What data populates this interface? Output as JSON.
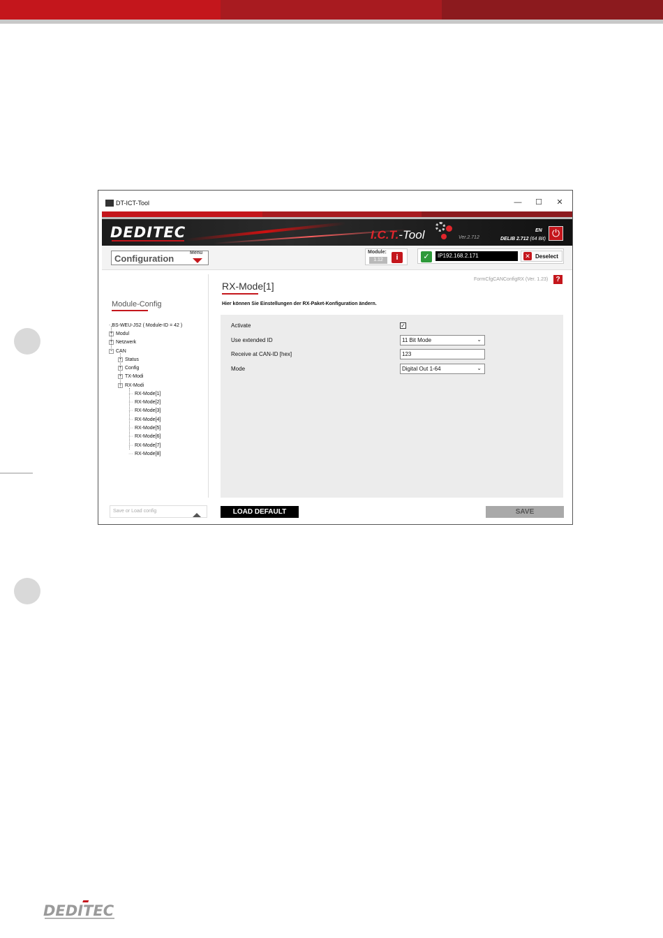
{
  "brand": {
    "red": "#c4161c",
    "dark_red": "#8c1a1e",
    "logo_text": "DEDITEC"
  },
  "window": {
    "title": "DT-ICT-Tool",
    "minimize_icon": "minimize-icon",
    "maximize_icon": "maximize-icon",
    "close_icon": "close-icon"
  },
  "header": {
    "logo": "DEDITEC",
    "product_red": "I.C.T.",
    "product_white": "-Tool",
    "version": "Ver.2.712",
    "language": "EN",
    "delib": "DELIB 2.712",
    "delib_arch": "(64 Bit)"
  },
  "toolbar": {
    "config_label": "Configuration",
    "menu_label": "Menu",
    "module_label": "Module:",
    "module_value": "1.12",
    "ip_address": "IP192.168.2.171",
    "deselect_label": "Deselect"
  },
  "sidebar": {
    "title": "Module-Config",
    "tree": {
      "root": "BS-WEU-JS2 ( Module-ID = 42 )",
      "modul": "Modul",
      "netzwerk": "Netzwerk",
      "can": "CAN",
      "status": "Status",
      "config": "Config",
      "tx_modi": "TX-Modi",
      "rx_modi": "RX-Modi",
      "rx_items": [
        "RX-Mode[1]",
        "RX-Mode[2]",
        "RX-Mode[3]",
        "RX-Mode[4]",
        "RX-Mode[5]",
        "RX-Mode[6]",
        "RX-Mode[7]",
        "RX-Mode[8]"
      ]
    },
    "save_load_placeholder": "Save or Load config"
  },
  "main": {
    "title": "RX-Mode[1]",
    "form_name": "FormCfgCANConfigRX (Ver. 1.23)",
    "description": "Hier können Sie Einstellungen der RX-Paket-Konfiguration ändern.",
    "fields": {
      "activate_label": "Activate",
      "activate_checked": "✓",
      "extended_id_label": "Use extended ID",
      "extended_id_value": "11 Bit Mode",
      "can_id_label": "Receive at CAN-ID [hex]",
      "can_id_value": "123",
      "mode_label": "Mode",
      "mode_value": "Digital Out 1-64"
    },
    "load_default_label": "LOAD DEFAULT",
    "save_label": "SAVE"
  }
}
